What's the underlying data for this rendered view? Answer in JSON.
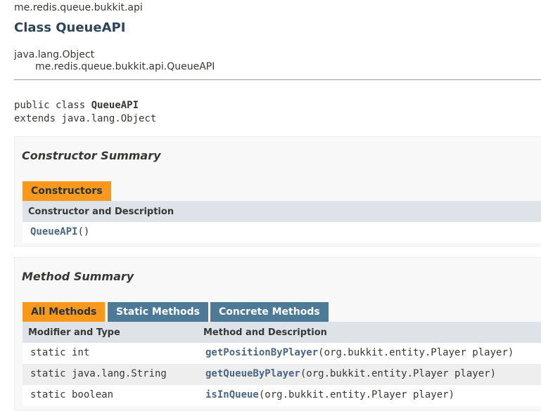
{
  "package_name": "me.redis.queue.bukkit.api",
  "class_title": "Class QueueAPI",
  "inheritance": {
    "parent": "java.lang.Object",
    "child": "me.redis.queue.bukkit.api.QueueAPI"
  },
  "signature": {
    "prefix": "public class ",
    "name": "QueueAPI",
    "extends_line": "extends java.lang.Object"
  },
  "constructor_summary": {
    "title": "Constructor Summary",
    "tab": "Constructors",
    "header": "Constructor and Description",
    "rows": [
      {
        "name": "QueueAPI",
        "params": "()"
      }
    ]
  },
  "method_summary": {
    "title": "Method Summary",
    "tabs": [
      "All Methods",
      "Static Methods",
      "Concrete Methods"
    ],
    "headers": [
      "Modifier and Type",
      "Method and Description"
    ],
    "rows": [
      {
        "modifier": "static int",
        "name": "getPositionByPlayer",
        "params": "(org.bukkit.entity.Player player)"
      },
      {
        "modifier": "static java.lang.String",
        "name": "getQueueByPlayer",
        "params": "(org.bukkit.entity.Player player)"
      },
      {
        "modifier": "static boolean",
        "name": "isInQueue",
        "params": "(org.bukkit.entity.Player player)"
      }
    ]
  },
  "colors": {
    "active_tab": "#f8981d",
    "inactive_tab": "#4d7a97",
    "link": "#4a6782",
    "header_bg": "#dee3e9"
  }
}
